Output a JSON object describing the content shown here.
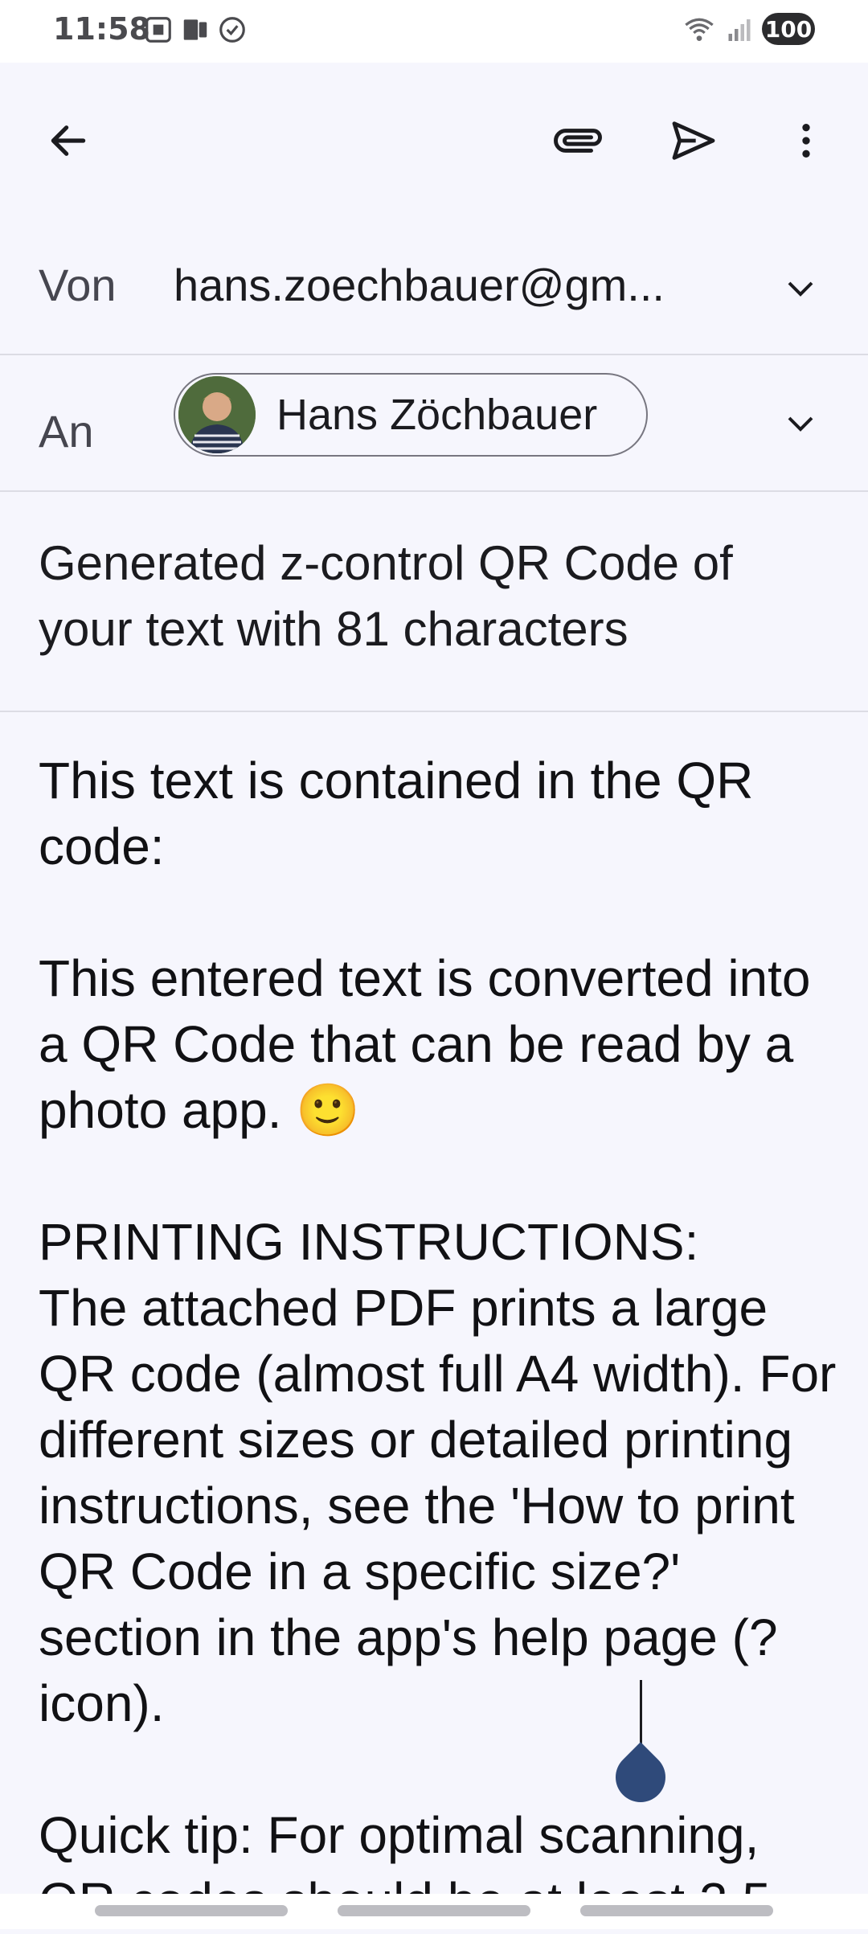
{
  "status": {
    "time": "11:58",
    "battery": "100",
    "icons_left": [
      "screenshot-icon",
      "device-icon",
      "check-circle-icon"
    ],
    "icons_right": [
      "wifi-icon",
      "signal-icon"
    ]
  },
  "toolbar": {
    "back_icon": "arrow-back-icon",
    "attach_icon": "attachment-icon",
    "send_icon": "send-icon",
    "more_icon": "more-vert-icon"
  },
  "from": {
    "label": "Von",
    "value": "hans.zoechbauer@gm..."
  },
  "to": {
    "label": "An",
    "recipient_name": "Hans Zöchbauer"
  },
  "subject": "Generated z-control QR Code of your text with 81 characters",
  "body": "This text is contained in the QR code:\n\nThis entered text is converted into a QR Code that can be read by a photo app. 🙂\n\nPRINTING INSTRUCTIONS:\nThe attached PDF prints a large QR code (almost full A4 width). For different sizes or detailed printing instructions, see the 'How to print QR Code in a specific size?' section in the app's help page (? icon).\n\nQuick tip: For optimal scanning, QR codes should be at least 2.5"
}
